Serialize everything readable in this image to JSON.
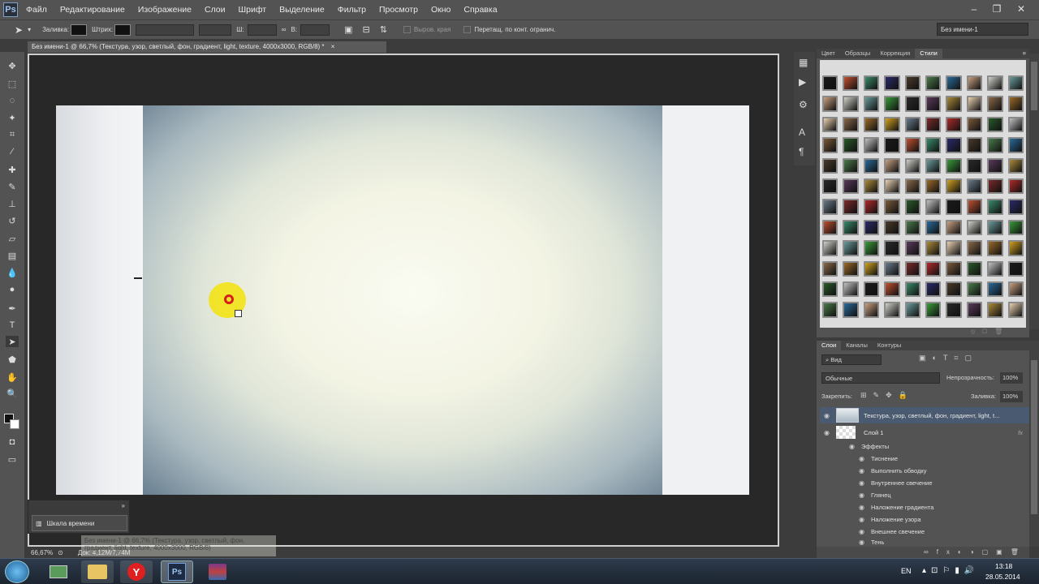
{
  "app": {
    "logo": "Ps"
  },
  "menu": [
    "Файл",
    "Редактирование",
    "Изображение",
    "Слои",
    "Шрифт",
    "Выделение",
    "Фильтр",
    "Просмотр",
    "Окно",
    "Справка"
  ],
  "options": {
    "fill_label": "Заливка:",
    "stroke_label": "Штрих:",
    "w_label": "Ш:",
    "h_label": "В:",
    "align_edges": "Выров. края",
    "constrain_path": "Перетащ. по конт. огранич.",
    "workspace": "Без имени-1"
  },
  "document": {
    "tab_title": "Без имени-1 @ 66,7% (Текстура, узор, светлый, фон, градиент, light, texture, 4000х3000, RGB/8) *",
    "close": "×"
  },
  "timeline": {
    "label": "Шкала времени"
  },
  "status": {
    "zoom": "66,67%",
    "doc_size": "Док: 4,12M/7,74M",
    "tooltip_line1": "Без имени-1 @ 66,7% (Текстура, узор, светлый, фон,",
    "tooltip_line2": "градиент, light, texture, 4000х3000, RGB/8)"
  },
  "styles_panel": {
    "tabs": [
      "Цвет",
      "Образцы",
      "Коррекция",
      "Стили"
    ],
    "active_tab": "Стили"
  },
  "layers_panel": {
    "tabs": [
      "Слои",
      "Каналы",
      "Контуры"
    ],
    "filter_kind": "Вид",
    "blend_mode": "Обычные",
    "opacity_label": "Непрозрачность:",
    "opacity_value": "100%",
    "lock_label": "Закрепить:",
    "fill_label": "Заливка:",
    "fill_value": "100%",
    "layers": [
      {
        "name": "Текстура, узор, светлый, фон, градиент, light, t..."
      },
      {
        "name": "Слой 1",
        "fx": "fx"
      }
    ],
    "effects_header": "Эффекты",
    "effects": [
      "Тиснение",
      "Выполнить обводку",
      "Внутреннее свечение",
      "Глянец",
      "Наложение градиента",
      "Наложение узора",
      "Внешнее свечение",
      "Тень"
    ]
  },
  "taskbar": {
    "lang": "EN",
    "time": "13:18",
    "date": "28.05.2014"
  }
}
